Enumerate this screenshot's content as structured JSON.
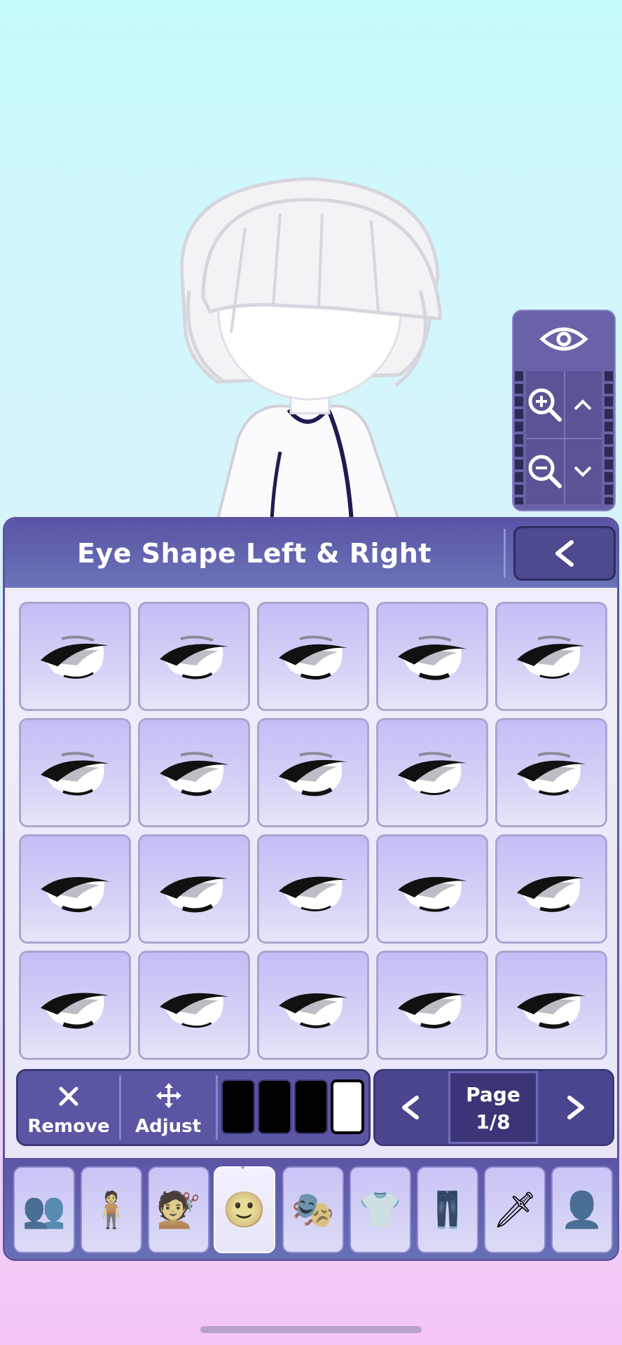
{
  "panel": {
    "title": "Eye Shape Left & Right",
    "back_icon": "chevron-left-icon"
  },
  "view_controls": {
    "visibility_icon": "eye-icon",
    "zoom_in_icon": "zoom-in-icon",
    "zoom_out_icon": "zoom-out-icon",
    "up_icon": "chevron-up-icon",
    "down_icon": "chevron-down-icon"
  },
  "tools": {
    "remove_label": "Remove",
    "adjust_label": "Adjust",
    "color_swatches": [
      "#000000",
      "#000000",
      "#000000",
      "#ffffff"
    ]
  },
  "pagination": {
    "page_label": "Page",
    "page_value": "1/8",
    "prev_label": "<",
    "next_label": ">"
  },
  "categories": [
    {
      "name": "presets",
      "icon": "characters-icon"
    },
    {
      "name": "body",
      "icon": "body-icon"
    },
    {
      "name": "hair",
      "icon": "hair-icon"
    },
    {
      "name": "face",
      "icon": "face-icon",
      "active": true
    },
    {
      "name": "accessories",
      "icon": "mask-hat-icon"
    },
    {
      "name": "top",
      "icon": "shirt-icon"
    },
    {
      "name": "bottom",
      "icon": "pants-icon"
    },
    {
      "name": "items",
      "icon": "sword-icon"
    },
    {
      "name": "profile",
      "icon": "profile-icon"
    }
  ],
  "eye_options_count": 20,
  "colors": {
    "panel": "#5b54a6",
    "tile": "#c4bef7",
    "active_tab": "#f2f1fc"
  }
}
